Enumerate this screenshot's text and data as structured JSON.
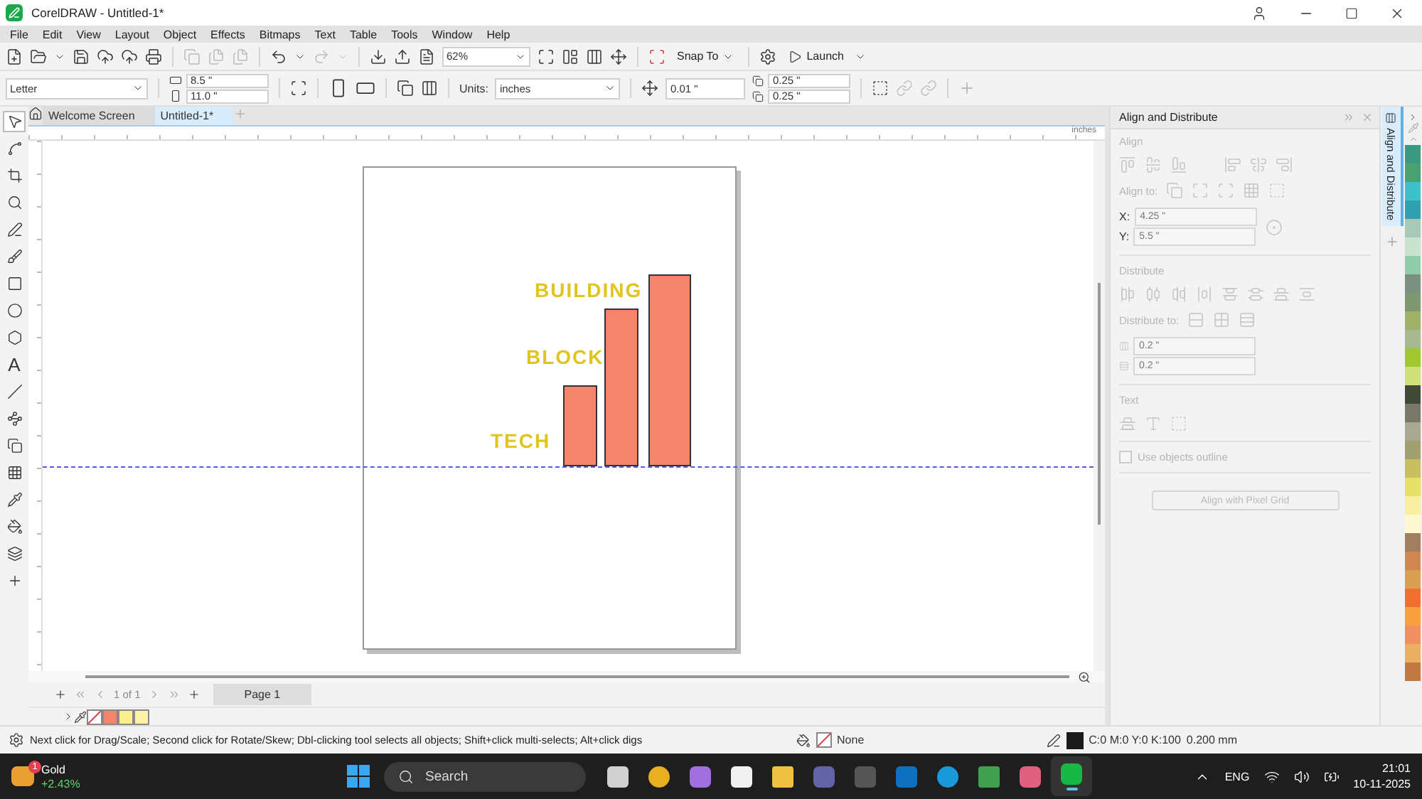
{
  "window": {
    "title": "CorelDRAW - Untitled-1*"
  },
  "menu": [
    "File",
    "Edit",
    "View",
    "Layout",
    "Object",
    "Effects",
    "Bitmaps",
    "Text",
    "Table",
    "Tools",
    "Window",
    "Help"
  ],
  "toolbar": {
    "zoom": "62%",
    "snap": "Snap To",
    "launch": "Launch"
  },
  "property_bar": {
    "page_size": "Letter",
    "width": "8.5 \"",
    "height": "11.0 \"",
    "units_label": "Units:",
    "units": "inches",
    "nudge": "0.01 \"",
    "dup_x": "0.25 \"",
    "dup_y": "0.25 \""
  },
  "tabs": [
    {
      "label": "Welcome Screen",
      "selected": false
    },
    {
      "label": "Untitled-1*",
      "selected": true
    }
  ],
  "ruler": {
    "unit": "inches"
  },
  "toolbox": [
    {
      "kind": "pick",
      "selected": true
    },
    {
      "kind": "shape",
      "selected": false
    },
    {
      "kind": "crop",
      "selected": false
    },
    {
      "kind": "zoom",
      "selected": false
    },
    {
      "kind": "curve",
      "selected": false
    },
    {
      "kind": "brush",
      "selected": false
    },
    {
      "kind": "rectangle",
      "selected": false
    },
    {
      "kind": "ellipse",
      "selected": false
    },
    {
      "kind": "polygon",
      "selected": false
    },
    {
      "kind": "text",
      "glyph": "A",
      "selected": false
    },
    {
      "kind": "line",
      "selected": false
    },
    {
      "kind": "connector",
      "selected": false
    },
    {
      "kind": "shadow",
      "selected": false
    },
    {
      "kind": "transparency",
      "selected": false
    },
    {
      "kind": "eyedropper",
      "selected": false
    },
    {
      "kind": "fill",
      "selected": false
    },
    {
      "kind": "smart",
      "selected": false
    },
    {
      "kind": "add",
      "selected": false
    }
  ],
  "canvas": {
    "labels": [
      "BUILDING",
      "BLOCK",
      "TECH"
    ]
  },
  "page_nav": {
    "counter": "1 of 1",
    "page": "Page 1"
  },
  "document_palette": [
    {
      "kind": "none"
    },
    {
      "kind": "swatch",
      "color": "#f4846a"
    },
    {
      "kind": "swatch",
      "color": "#fcef8e"
    },
    {
      "kind": "swatch",
      "color": "#fdf3a4"
    }
  ],
  "docker": {
    "title": "Align and Distribute",
    "disabled": true,
    "align": "Align",
    "align_to": "Align to:",
    "x_label": "X:",
    "x": "4.25 \"",
    "y_label": "Y:",
    "y": "5.5 \"",
    "distribute": "Distribute",
    "distribute_to": "Distribute to:",
    "spacing_h": "0.2 \"",
    "spacing_v": "0.2 \"",
    "text": "Text",
    "outline": {
      "label": "Use objects outline",
      "checked": false
    },
    "pixel_button": "Align with Pixel Grid",
    "tab": "Align and Distribute"
  },
  "palette": [
    {
      "color": "#3a9a80"
    },
    {
      "color": "#4aa070"
    },
    {
      "color": "#40c0c8"
    },
    {
      "color": "#30a0b0"
    },
    {
      "color": "#a8c8b8"
    },
    {
      "color": "#c8e4d0"
    },
    {
      "color": "#90cca8"
    },
    {
      "color": "#7a9080"
    },
    {
      "color": "#809870"
    },
    {
      "color": "#a0b068"
    },
    {
      "color": "#a8b890"
    },
    {
      "color": "#a0c830"
    },
    {
      "color": "#d0e078"
    },
    {
      "color": "#404838"
    },
    {
      "color": "#787868"
    },
    {
      "color": "#a8a890"
    },
    {
      "color": "#a0a070"
    },
    {
      "color": "#c8c060"
    },
    {
      "color": "#e8e068"
    },
    {
      "color": "#f8f0a0"
    },
    {
      "color": "#fff8d0"
    },
    {
      "color": "#a08060"
    },
    {
      "color": "#d08850"
    },
    {
      "color": "#d8a050"
    },
    {
      "color": "#f07030"
    },
    {
      "color": "#f8a040"
    },
    {
      "color": "#f09060"
    },
    {
      "color": "#e8b060"
    },
    {
      "color": "#c07840"
    }
  ],
  "status": {
    "hint": "Next click for Drag/Scale; Second click for Rotate/Skew; Dbl-clicking tool selects all objects; Shift+click multi-selects; Alt+click digs",
    "fill": "None",
    "outline_color": "C:0 M:0 Y:0 K:100",
    "outline_width": "0.200 mm"
  },
  "taskbar": {
    "widget": {
      "title": "Gold",
      "change": "+2.43%",
      "badge": "1"
    },
    "search": "Search",
    "language": "ENG",
    "time": "21:01",
    "date": "10-11-2025",
    "apps": [
      {
        "kind": "taskview",
        "selected": false
      },
      {
        "kind": "chrome",
        "selected": false
      },
      {
        "kind": "copilot",
        "selected": false
      },
      {
        "kind": "store",
        "selected": false
      },
      {
        "kind": "folder",
        "selected": false
      },
      {
        "kind": "teams",
        "selected": false
      },
      {
        "kind": "notion",
        "selected": false
      },
      {
        "kind": "mail",
        "selected": false
      },
      {
        "kind": "edge",
        "selected": false
      },
      {
        "kind": "sheet",
        "selected": false
      },
      {
        "kind": "suite",
        "selected": false
      },
      {
        "kind": "coreldraw",
        "selected": true
      }
    ]
  }
}
